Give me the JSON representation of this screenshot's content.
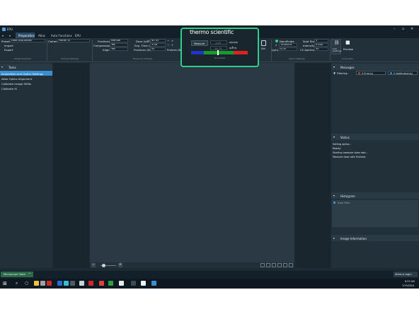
{
  "window": {
    "title": "EPU"
  },
  "menu": {
    "tabs": [
      "Preparation",
      "Atlas",
      "Auto Functions",
      "EPU"
    ],
    "active": "Preparation"
  },
  "ribbon": {
    "presets_label": "Presets",
    "presets_value": "Data Acquisition",
    "import": "Import",
    "export": "Export",
    "camera_label": "Camera",
    "camera_value": "Falcon 4i",
    "fractions_label": "Fractions",
    "fractions_value": "Manual",
    "compression_label": "Compression",
    "compression_value": "Yes",
    "align_label": "Align",
    "align_value": "Yes",
    "dose_label": "Dose (e/Å²)",
    "dose_value": "40.33",
    "exp_time_label": "Exp. Time (s)",
    "exp_time_value": "3.98",
    "fractions_nr_label": "Fractions (Nr)",
    "fractions_nr_value": "45",
    "frames_label": "Frames (Nr",
    "set_button": "Set",
    "nanoprobe": "NanoProbe",
    "magnification": "190000×",
    "defocus_label": "(µm)",
    "defocus_value": "0.00",
    "spot_size_label": "Spot Size",
    "spot_size_value": "3",
    "intensity_label": "Intensity",
    "intensity_value": "0.440",
    "c2_aperture_label": "C2 Aperture",
    "c2_aperture_value": "50",
    "link_settings": "Link Settings",
    "preview": "Preview",
    "group_preset": "Preset Selection",
    "group_camera": "Camera Settings",
    "group_exposure": "Exposure Settings",
    "group_dose": "Dose Rate",
    "group_optics": "Optics Settings",
    "group_acquisition": "Acquisition"
  },
  "dose_popup": {
    "brand": "thermo scientific",
    "measure_button": "Measure",
    "value1": "1.22",
    "unit1": "e/pix/s",
    "value2": "15.73",
    "unit2": "e/Å²/s",
    "label": "Dose Rate"
  },
  "tasks": {
    "title": "Tasks",
    "items": [
      "Acquisition and Optics Settings",
      "Atlas Optics Alignment",
      "Calibrate Image Shifts",
      "Calibrate IS"
    ]
  },
  "messages": {
    "title": "Messages",
    "filtering_label": "Filtering:",
    "errors": "0 Error(s)",
    "notifications": "0 Notification(s)"
  },
  "status_panel": {
    "title": "Status",
    "lines": [
      "Setting optics...",
      "Ready!",
      "Starting measure dose rate...",
      "Measure dose rate finished."
    ]
  },
  "histogram": {
    "title": "Histogram",
    "auto_filter": "Auto Filter"
  },
  "image_info": {
    "title": "Image Information"
  },
  "statusbar": {
    "microscope_state": "Microscope State",
    "user": "Athena Login"
  },
  "taskbar": {
    "time": "8:59 AM",
    "date": "7/19/2024"
  },
  "colors": {
    "highlight": "#2ecf87",
    "selected": "#3a8fd0"
  }
}
